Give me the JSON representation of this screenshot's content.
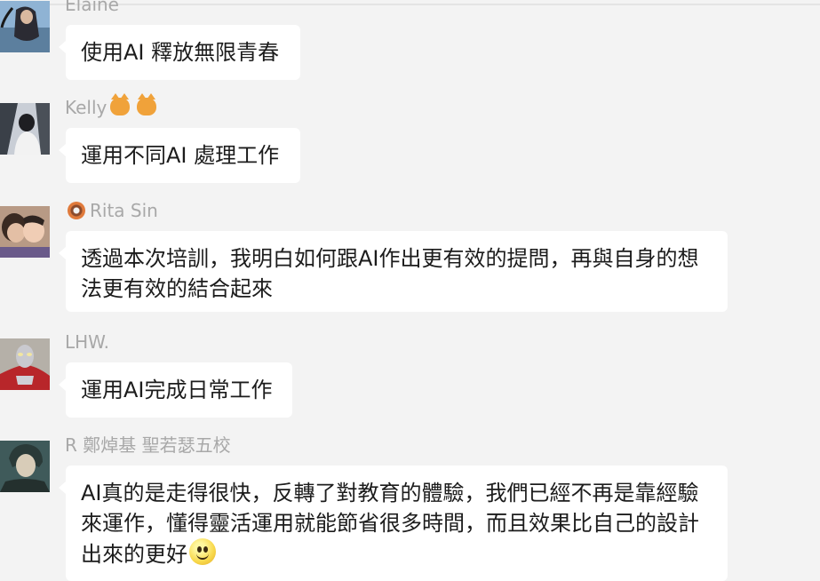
{
  "messages": [
    {
      "sender": "Elaine",
      "text": "使用AI 釋放無限青春"
    },
    {
      "sender": "Kelly",
      "sender_emojis": [
        "cat-face-icon",
        "cat-face-icon"
      ],
      "text": "運用不同AI 處理工作"
    },
    {
      "sender": "Rita Sin",
      "sender_prefix_icon": "donut-icon",
      "text_lines": [
        "透過本次培訓，我明白如何跟AI作出更有效的提問，再與自身的想",
        "法更有效的結合起來"
      ]
    },
    {
      "sender": "LHW.",
      "text": "運用AI完成日常工作"
    },
    {
      "sender": "R 鄭焯基 聖若瑟五校",
      "text_lines": [
        "AI真的是走得很快，反轉了對教育的體驗，我們已經不再是靠經驗",
        "來運作，懂得靈活運用就能節省很多時間，而且效果比自己的設計",
        "出來的更好"
      ],
      "text_suffix_icon": "smiling-face-icon"
    }
  ]
}
